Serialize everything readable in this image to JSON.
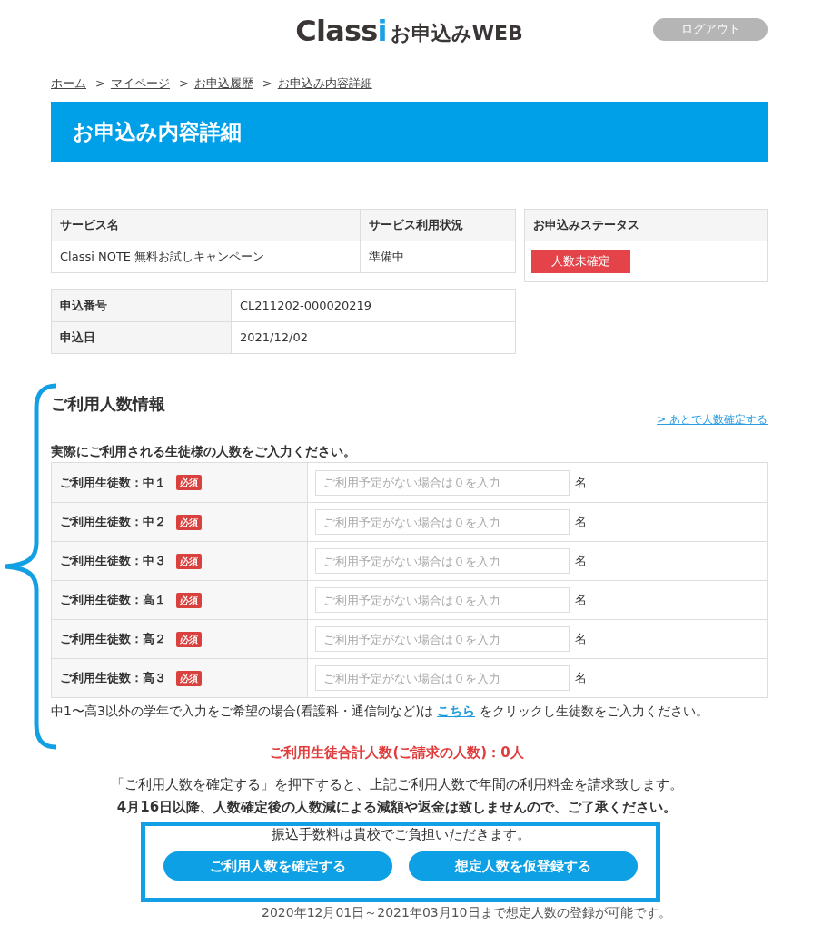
{
  "header": {
    "logo": "Classi",
    "site_title": "お申込みWEB",
    "logout_button": "ログアウト"
  },
  "breadcrumb": [
    {
      "label": "ホーム"
    },
    {
      "prefix": ">",
      "label": "マイページ"
    },
    {
      "prefix": ">",
      "label": "お申込履歴"
    },
    {
      "prefix": ">",
      "label": "お申込み内容詳細"
    }
  ],
  "page_title": "お申込み内容詳細",
  "service_table": {
    "columns": [
      "サービス名",
      "サービス利用状況"
    ],
    "rows": [
      [
        "Classi NOTE 無料お試しキャンペーン",
        "準備中"
      ]
    ]
  },
  "status": {
    "heading": "お申込みステータス",
    "badge": "人数未確定"
  },
  "application_table": {
    "rows": [
      {
        "label": "申込番号",
        "value": "CL211202-000020219"
      },
      {
        "label": "申込日",
        "value": "2021/12/02"
      }
    ]
  },
  "usage_section": {
    "title": "ご利用人数情報",
    "later_link": "> あとで人数確定する",
    "instruction": "実際にご利用される生徒様の人数をご入力ください。",
    "rows": [
      {
        "label": "ご利用生徒数：中１",
        "required_badge": "必須",
        "placeholder": "ご利用予定がない場合は０を入力",
        "unit": "名"
      },
      {
        "label": "ご利用生徒数：中２",
        "required_badge": "必須",
        "placeholder": "ご利用予定がない場合は０を入力",
        "unit": "名"
      },
      {
        "label": "ご利用生徒数：中３",
        "required_badge": "必須",
        "placeholder": "ご利用予定がない場合は０を入力",
        "unit": "名"
      },
      {
        "label": "ご利用生徒数：高１",
        "required_badge": "必須",
        "placeholder": "ご利用予定がない場合は０を入力",
        "unit": "名"
      },
      {
        "label": "ご利用生徒数：高２",
        "required_badge": "必須",
        "placeholder": "ご利用予定がない場合は０を入力",
        "unit": "名"
      },
      {
        "label": "ご利用生徒数：高３",
        "required_badge": "必須",
        "placeholder": "ご利用予定がない場合は０を入力",
        "unit": "名"
      }
    ],
    "note": {
      "before": "中1〜高3以外の学年で入力をご希望の場合(看護科・通信制など)は",
      "link": "こちら",
      "after": "をクリックし生徒数をご入力ください。"
    }
  },
  "total": "ご利用生徒合計人数(ご請求の人数)：0人",
  "notices": [
    {
      "text": "「ご利用人数を確定する」を押下すると、上記ご利用人数で年間の利用料金を請求致します。",
      "bold": false
    },
    {
      "text": "4月16日以降、人数確定後の人数減による減額や返金は致しませんので、ご了承ください。",
      "bold": true
    }
  ],
  "fee_notice": "振込手数料は貴校でご負担いただきます。",
  "buttons": [
    "ご利用人数を確定する",
    "想定人数を仮登録する"
  ],
  "period_notice": "2020年12月01日～2021年03月10日まで想定人数の登録が可能です。"
}
